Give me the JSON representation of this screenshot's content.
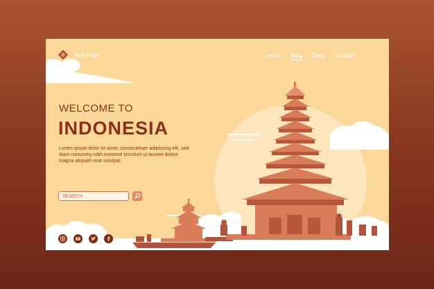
{
  "logo": {
    "label": "Your Logo"
  },
  "nav": {
    "items": [
      "Home",
      "Blog",
      "Shop",
      "Contact"
    ],
    "active": "Blog"
  },
  "hero": {
    "welcome": "WELCOME TO",
    "title": "INDONESIA",
    "description": "Lorem ipsum dolor sit amet, consectetuer adipiscing elit, sed diam nonummy nibh euismod tincidunt ut laoreet dolore magna aliquam erat volutpat."
  },
  "search": {
    "placeholder": "SEARCH"
  },
  "social": [
    "instagram-icon",
    "youtube-icon",
    "twitter-icon",
    "facebook-icon"
  ],
  "colors": {
    "background": "#8b3a22",
    "card": "#fbd89a",
    "title": "#8b2f1c",
    "temple": "#d87d58",
    "sun": "#fde9c4",
    "cloud": "#ffffff"
  }
}
